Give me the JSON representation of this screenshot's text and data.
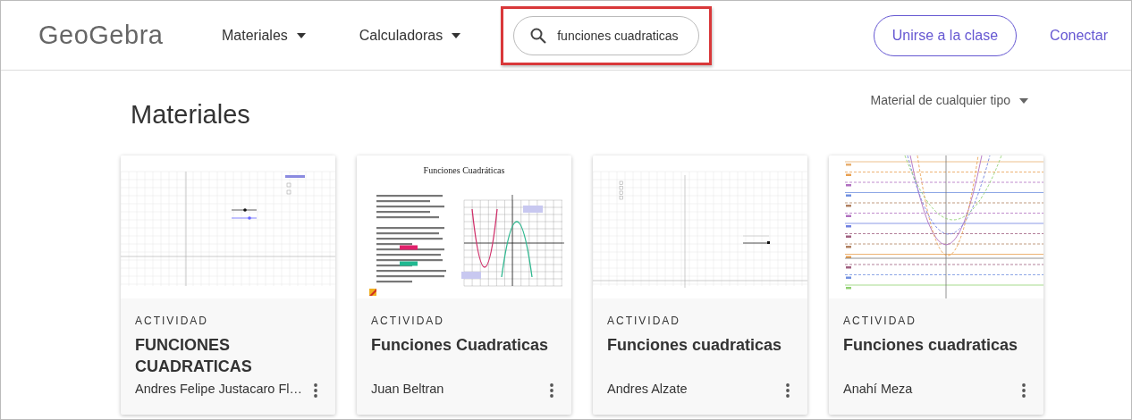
{
  "logo": {
    "text": "GeoGebra"
  },
  "nav": [
    {
      "label": "Materiales"
    },
    {
      "label": "Calculadoras"
    }
  ],
  "search": {
    "value": "funciones cuadraticas",
    "highlighted": true
  },
  "actions": {
    "join": "Unirse a la clase",
    "login": "Conectar"
  },
  "heading": "Materiales",
  "filter": {
    "label": "Material de cualquier tipo"
  },
  "cards": [
    {
      "type": "ACTIVIDAD",
      "title": "FUNCIONES CUADRATICAS",
      "author": "Andres Felipe Justacaro Fl…",
      "thumbnail": {
        "kind": "sliders"
      }
    },
    {
      "type": "ACTIVIDAD",
      "title": "Funciones Cuadraticas",
      "author": "Juan Beltran",
      "thumbnail": {
        "kind": "worksheet",
        "title": "Funciones Cuadráticas"
      }
    },
    {
      "type": "ACTIVIDAD",
      "title": "Funciones cuadraticas",
      "author": "Andres Alzate",
      "thumbnail": {
        "kind": "checkboxes"
      }
    },
    {
      "type": "ACTIVIDAD",
      "title": "Funciones cuadraticas",
      "author": "Anahí Meza",
      "thumbnail": {
        "kind": "parabolas"
      }
    }
  ]
}
